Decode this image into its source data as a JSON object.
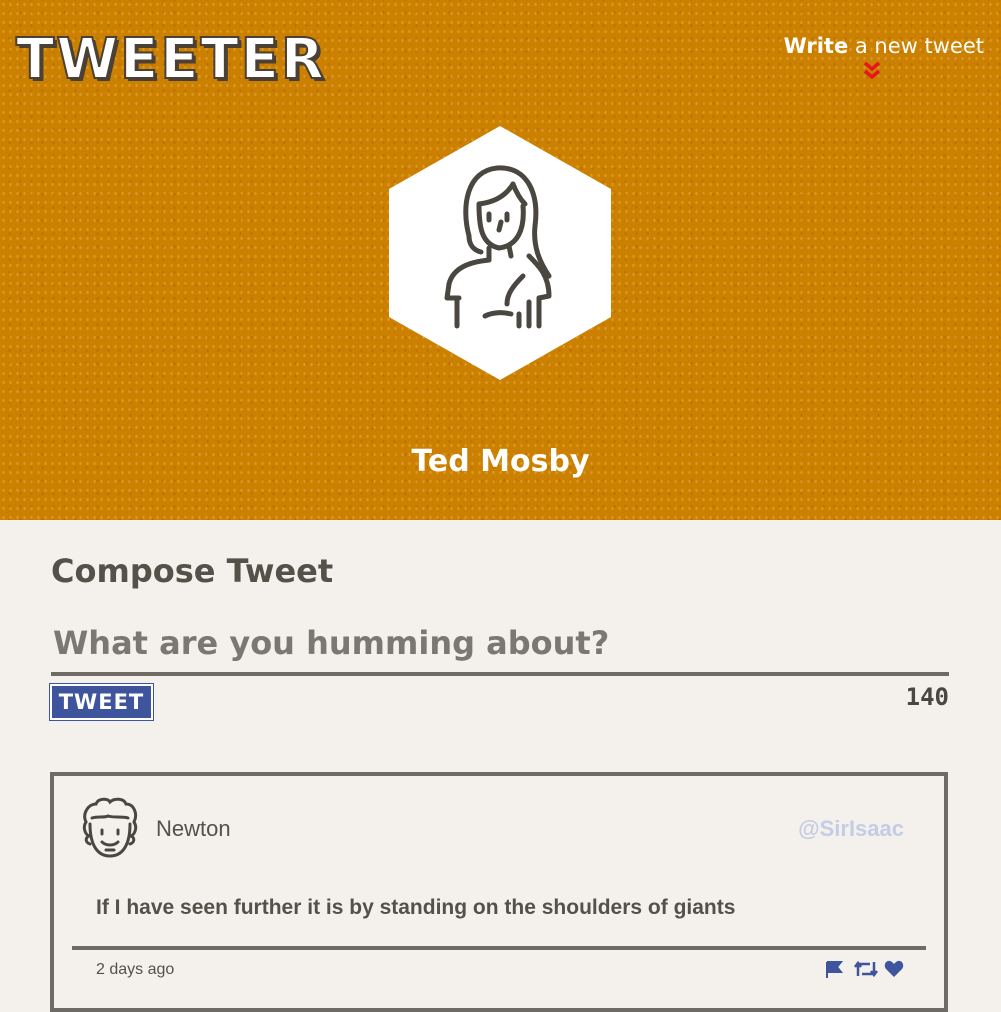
{
  "header": {
    "logo": "TWEETER",
    "nav": {
      "bold": "Write",
      "rest": " a new tweet",
      "icon": "double-chevron-down-icon"
    },
    "user_name": "Ted Mosby"
  },
  "compose": {
    "title": "Compose Tweet",
    "placeholder": "What are you humming about?",
    "button_label": "TWEET",
    "counter": "140"
  },
  "tweets": [
    {
      "author": "Newton",
      "handle": "@SirIsaac",
      "text": "If I have seen further it is by standing on the shoulders of giants",
      "time": "2 days ago",
      "actions": [
        "flag-icon",
        "retweet-icon",
        "heart-icon"
      ]
    }
  ],
  "colors": {
    "header_bg": "#cc8000",
    "page_bg": "#f4f1ec",
    "accent": "#3e559d",
    "text": "#545149",
    "handle": "#c4cce6",
    "arrow": "#e8161b"
  }
}
